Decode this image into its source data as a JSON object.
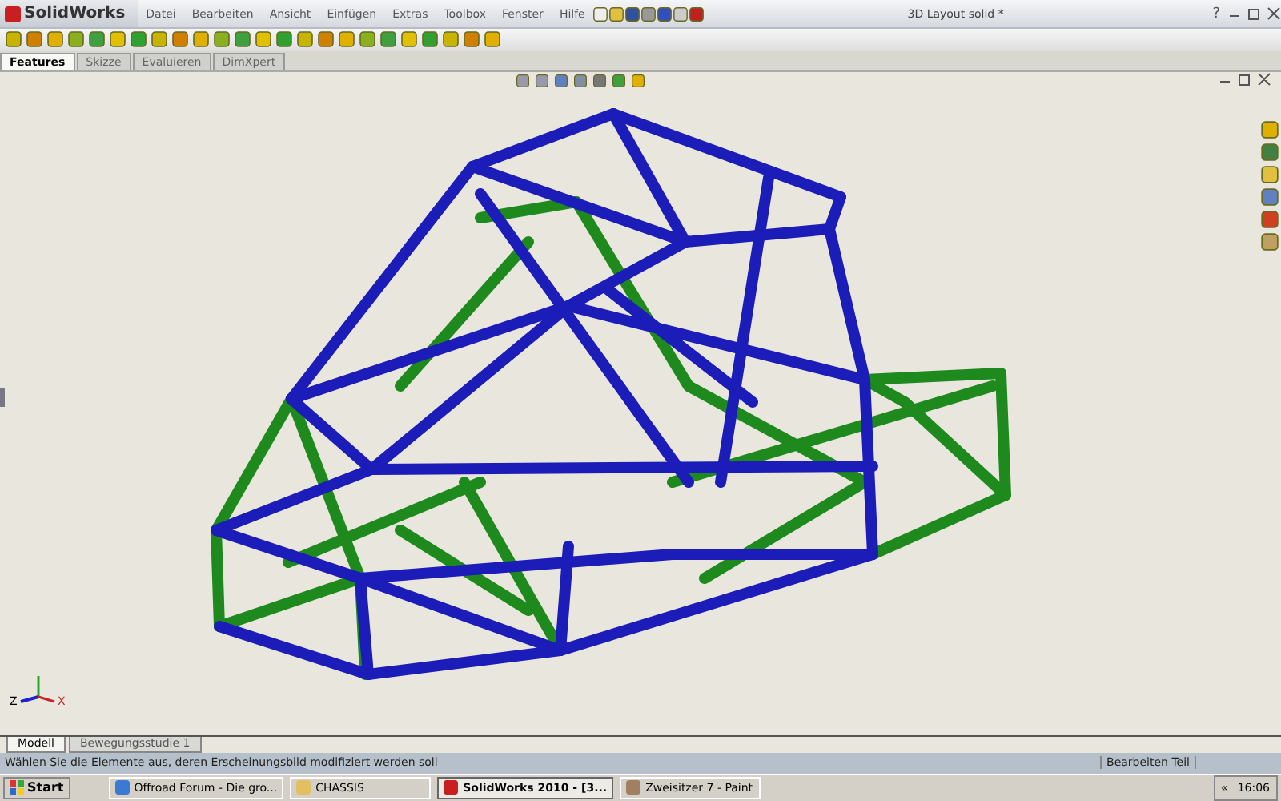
{
  "app": {
    "name": "SolidWorks"
  },
  "menu": [
    "Datei",
    "Bearbeiten",
    "Ansicht",
    "Einfügen",
    "Extras",
    "Toolbox",
    "Fenster",
    "Hilfe"
  ],
  "document_title": "3D Layout solid *",
  "help": "?",
  "tabs": [
    {
      "label": "Features",
      "selected": true
    },
    {
      "label": "Skizze",
      "selected": false
    },
    {
      "label": "Evaluieren",
      "selected": false
    },
    {
      "label": "DimXpert",
      "selected": false
    }
  ],
  "triad": {
    "z": "Z",
    "x": "X"
  },
  "model_tabs": [
    {
      "label": "Modell",
      "selected": true
    },
    {
      "label": "Bewegungsstudie 1",
      "selected": false
    }
  ],
  "status_bar": {
    "message": "Wählen Sie die Elemente aus, deren Erscheinungsbild modifiziert werden soll",
    "mode": "Bearbeiten Teil"
  },
  "taskbar": {
    "start": "Start",
    "items": [
      {
        "label": "Offroad Forum - Die gro...",
        "selected": false
      },
      {
        "label": "CHASSIS",
        "selected": false
      },
      {
        "label": "SolidWorks 2010 - [3...",
        "selected": true
      },
      {
        "label": "Zweisitzer 7 - Paint",
        "selected": false
      }
    ],
    "tray_toggle": "«",
    "clock": "16:06"
  }
}
